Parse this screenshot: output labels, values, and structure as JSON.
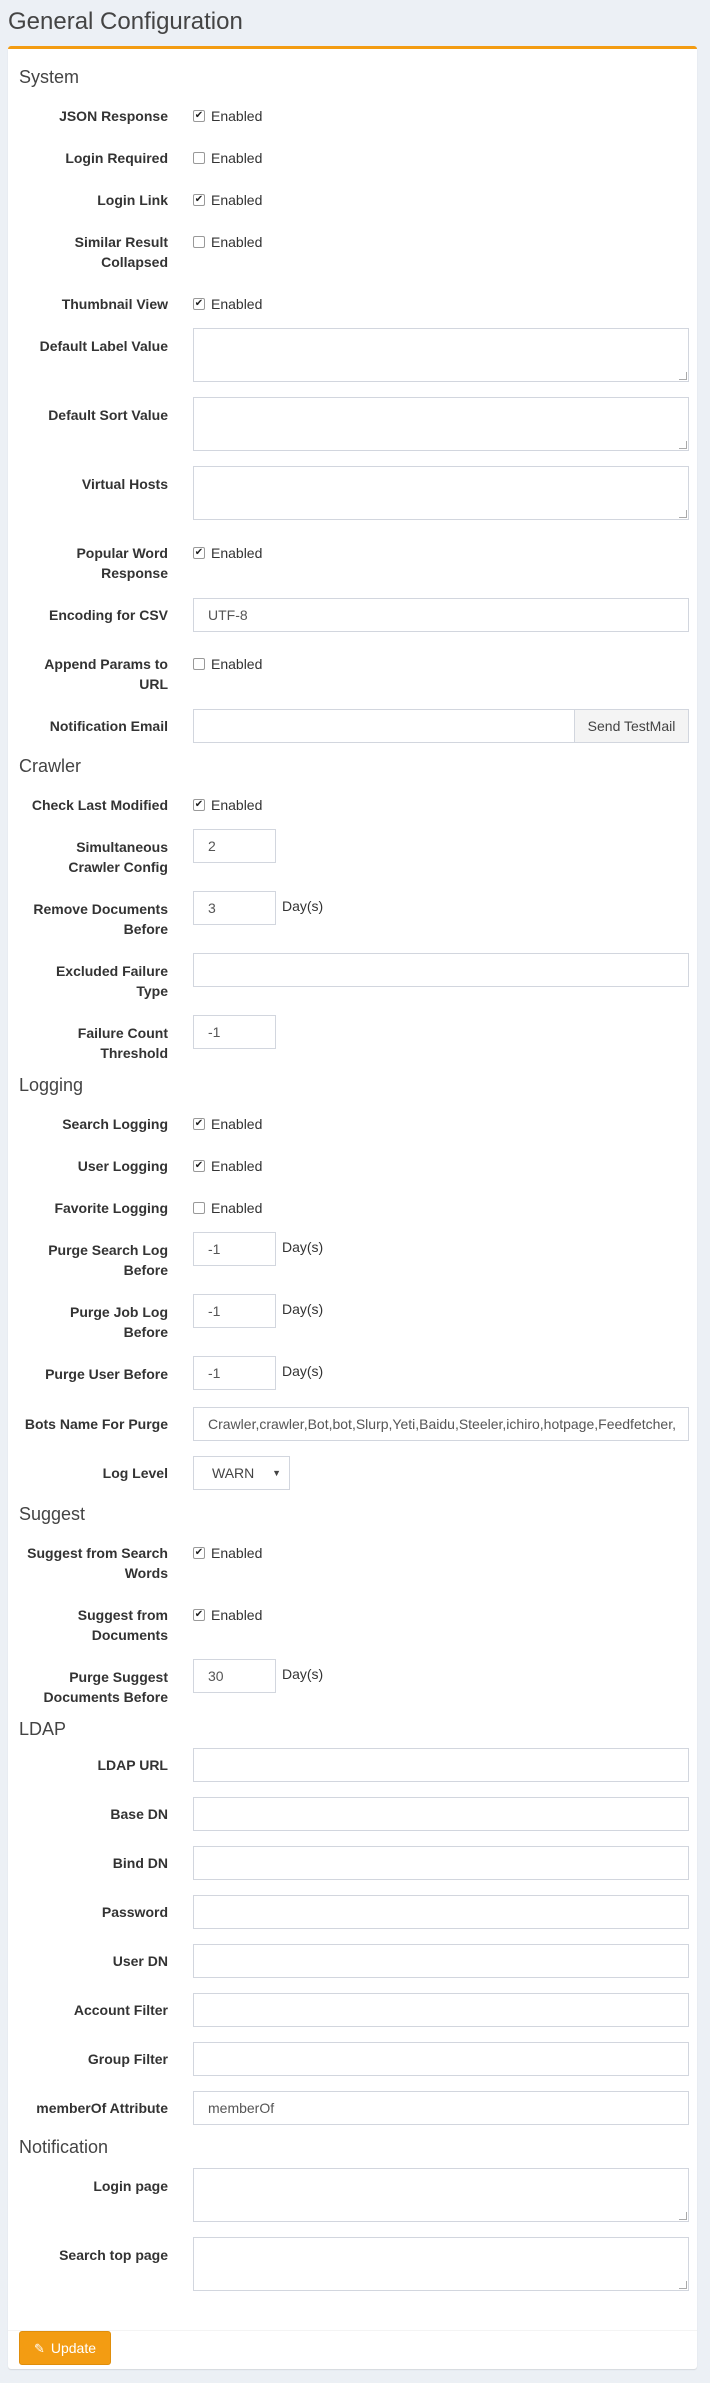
{
  "page": {
    "title": "General Configuration"
  },
  "system": {
    "title": "System",
    "json_response": {
      "label": "JSON Response",
      "checked": true,
      "text": "Enabled"
    },
    "login_required": {
      "label": "Login Required",
      "checked": false,
      "text": "Enabled"
    },
    "login_link": {
      "label": "Login Link",
      "checked": true,
      "text": "Enabled"
    },
    "similar_result_collapsed": {
      "label1": "Similar Result",
      "label2": "Collapsed",
      "checked": false,
      "text": "Enabled"
    },
    "thumbnail_view": {
      "label": "Thumbnail View",
      "checked": true,
      "text": "Enabled"
    },
    "default_label_value": {
      "label": "Default Label Value",
      "value": ""
    },
    "default_sort_value": {
      "label": "Default Sort Value",
      "value": ""
    },
    "virtual_hosts": {
      "label": "Virtual Hosts",
      "value": ""
    },
    "popular_word_response": {
      "label1": "Popular Word",
      "label2": "Response",
      "checked": true,
      "text": "Enabled"
    },
    "encoding_for_csv": {
      "label": "Encoding for CSV",
      "value": "UTF-8"
    },
    "append_params": {
      "label1": "Append Params to",
      "label2": "URL",
      "checked": false,
      "text": "Enabled"
    },
    "notification_email": {
      "label": "Notification Email",
      "value": "",
      "button": "Send TestMail"
    }
  },
  "crawler": {
    "title": "Crawler",
    "check_last_modified": {
      "label": "Check Last Modified",
      "checked": true,
      "text": "Enabled"
    },
    "simultaneous_config": {
      "label1": "Simultaneous",
      "label2": "Crawler Config",
      "value": "2"
    },
    "remove_documents_before": {
      "label1": "Remove Documents",
      "label2": "Before",
      "value": "3",
      "suffix": "Day(s)"
    },
    "excluded_failure_type": {
      "label1": "Excluded Failure",
      "label2": "Type",
      "value": ""
    },
    "failure_count_threshold": {
      "label1": "Failure Count",
      "label2": "Threshold",
      "value": "-1"
    }
  },
  "logging": {
    "title": "Logging",
    "search_logging": {
      "label": "Search Logging",
      "checked": true,
      "text": "Enabled"
    },
    "user_logging": {
      "label": "User Logging",
      "checked": true,
      "text": "Enabled"
    },
    "favorite_logging": {
      "label": "Favorite Logging",
      "checked": false,
      "text": "Enabled"
    },
    "purge_search_log": {
      "label1": "Purge Search Log",
      "label2": "Before",
      "value": "-1",
      "suffix": "Day(s)"
    },
    "purge_job_log": {
      "label1": "Purge Job Log",
      "label2": "Before",
      "value": "-1",
      "suffix": "Day(s)"
    },
    "purge_user_before": {
      "label": "Purge User Before",
      "value": "-1",
      "suffix": "Day(s)"
    },
    "bots_name_for_purge": {
      "label": "Bots Name For Purge",
      "value": "Crawler,crawler,Bot,bot,Slurp,Yeti,Baidu,Steeler,ichiro,hotpage,Feedfetcher,"
    },
    "log_level": {
      "label": "Log Level",
      "value": "WARN"
    }
  },
  "suggest": {
    "title": "Suggest",
    "from_search_words": {
      "label1": "Suggest from Search",
      "label2": "Words",
      "checked": true,
      "text": "Enabled"
    },
    "from_documents": {
      "label1": "Suggest from",
      "label2": "Documents",
      "checked": true,
      "text": "Enabled"
    },
    "purge_suggest": {
      "label1": "Purge Suggest",
      "label2": "Documents Before",
      "value": "30",
      "suffix": "Day(s)"
    }
  },
  "ldap": {
    "title": "LDAP",
    "ldap_url": {
      "label": "LDAP URL",
      "value": ""
    },
    "base_dn": {
      "label": "Base DN",
      "value": ""
    },
    "bind_dn": {
      "label": "Bind DN",
      "value": ""
    },
    "password": {
      "label": "Password",
      "value": ""
    },
    "user_dn": {
      "label": "User DN",
      "value": ""
    },
    "account_filter": {
      "label": "Account Filter",
      "value": ""
    },
    "group_filter": {
      "label": "Group Filter",
      "value": ""
    },
    "member_of": {
      "label": "memberOf Attribute",
      "value": "memberOf"
    }
  },
  "notification": {
    "title": "Notification",
    "login_page": {
      "label": "Login page",
      "value": ""
    },
    "search_top_page": {
      "label": "Search top page",
      "value": ""
    }
  },
  "footer": {
    "update_label": "Update"
  },
  "icons": {
    "check": "✔",
    "caret": "▼",
    "pencil": "✎"
  },
  "colors": {
    "accent": "#f39c12",
    "background": "#ecf0f5"
  }
}
